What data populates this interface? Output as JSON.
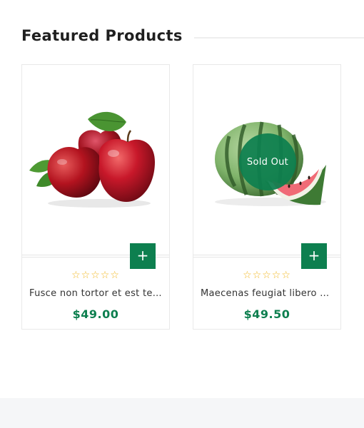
{
  "section": {
    "title": "Featured Products"
  },
  "products": [
    {
      "name": "Fusce non tortor et est tempus",
      "price": "$49.00",
      "rating_stars": "☆☆☆☆☆",
      "rating": 0,
      "add_label": "+",
      "image": "apples-image"
    },
    {
      "name": "Maecenas feugiat libero sit amet",
      "price": "$49.50",
      "rating_stars": "☆☆☆☆☆",
      "rating": 0,
      "add_label": "+",
      "badge": "Sold Out",
      "image": "watermelon-image"
    }
  ],
  "colors": {
    "accent": "#0d7f4f",
    "star": "#f1b722",
    "footer_band": "#f5f6f8"
  }
}
